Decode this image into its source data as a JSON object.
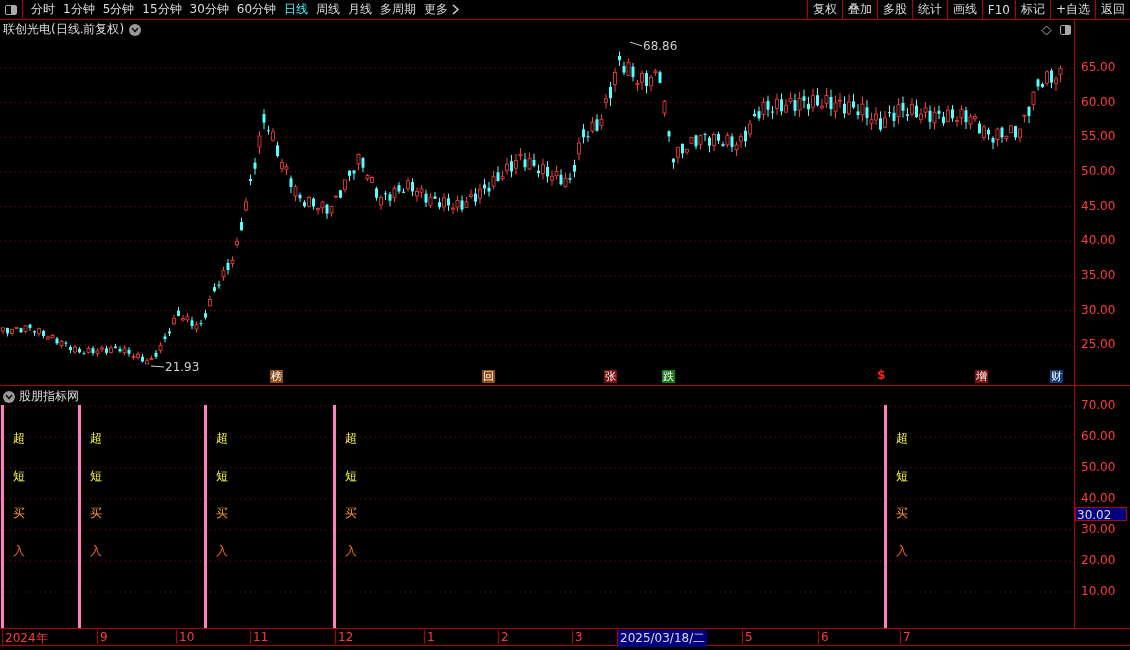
{
  "toolbar": {
    "periods": [
      {
        "label": "分时",
        "selected": false
      },
      {
        "label": "1分钟",
        "selected": false
      },
      {
        "label": "5分钟",
        "selected": false
      },
      {
        "label": "15分钟",
        "selected": false
      },
      {
        "label": "30分钟",
        "selected": false
      },
      {
        "label": "60分钟",
        "selected": false
      },
      {
        "label": "日线",
        "selected": true
      },
      {
        "label": "周线",
        "selected": false
      },
      {
        "label": "月线",
        "selected": false
      },
      {
        "label": "多周期",
        "selected": false
      },
      {
        "label": "更多",
        "selected": false
      }
    ],
    "buttons": [
      "复权",
      "叠加",
      "多股",
      "统计",
      "画线",
      "F10",
      "标记",
      "+自选",
      "返回"
    ]
  },
  "main_chart": {
    "title": "联创光电(日线.前复权)",
    "high_label": "68.86",
    "low_label": "21.93",
    "markers": [
      {
        "text": "榜",
        "kind": "badge",
        "color": "#8a4a14"
      },
      {
        "text": "回",
        "kind": "badge",
        "color": "#8a4a14"
      },
      {
        "text": "张",
        "kind": "badge",
        "color": "#7a1010"
      },
      {
        "text": "跌",
        "kind": "badge",
        "color": "#1a7a1a"
      },
      {
        "text": "$",
        "kind": "symbol",
        "color": "#ff2020"
      },
      {
        "text": "增",
        "kind": "badge",
        "color": "#7a1010"
      },
      {
        "text": "财",
        "kind": "badge",
        "color": "#143c78"
      }
    ],
    "axis": [
      "65.00",
      "60.00",
      "55.00",
      "50.00",
      "45.00",
      "40.00",
      "35.00",
      "30.00",
      "25.00"
    ]
  },
  "indicator": {
    "title": "股朋指标网",
    "signals": [
      {
        "labels": [
          "超",
          "短",
          "买",
          "入"
        ]
      },
      {
        "labels": [
          "超",
          "短",
          "买",
          "入"
        ]
      },
      {
        "labels": [
          "超",
          "短",
          "买",
          "入"
        ]
      },
      {
        "labels": [
          "超",
          "短",
          "买",
          "入"
        ]
      },
      {
        "labels": [
          "超",
          "短",
          "买",
          "入"
        ]
      }
    ],
    "axis": [
      "70.00",
      "60.00",
      "50.00",
      "40.00",
      "30.00",
      "20.00",
      "10.00"
    ],
    "current_value": "30.02"
  },
  "date_axis": [
    {
      "label": "2024年",
      "selected": false
    },
    {
      "label": "9",
      "selected": false
    },
    {
      "label": "10",
      "selected": false
    },
    {
      "label": "11",
      "selected": false
    },
    {
      "label": "12",
      "selected": false
    },
    {
      "label": "1",
      "selected": false
    },
    {
      "label": "2",
      "selected": false
    },
    {
      "label": "3",
      "selected": false
    },
    {
      "label": "2025/03/18/二",
      "selected": true
    },
    {
      "label": "5",
      "selected": false
    },
    {
      "label": "6",
      "selected": false
    },
    {
      "label": "7",
      "selected": false
    }
  ]
}
